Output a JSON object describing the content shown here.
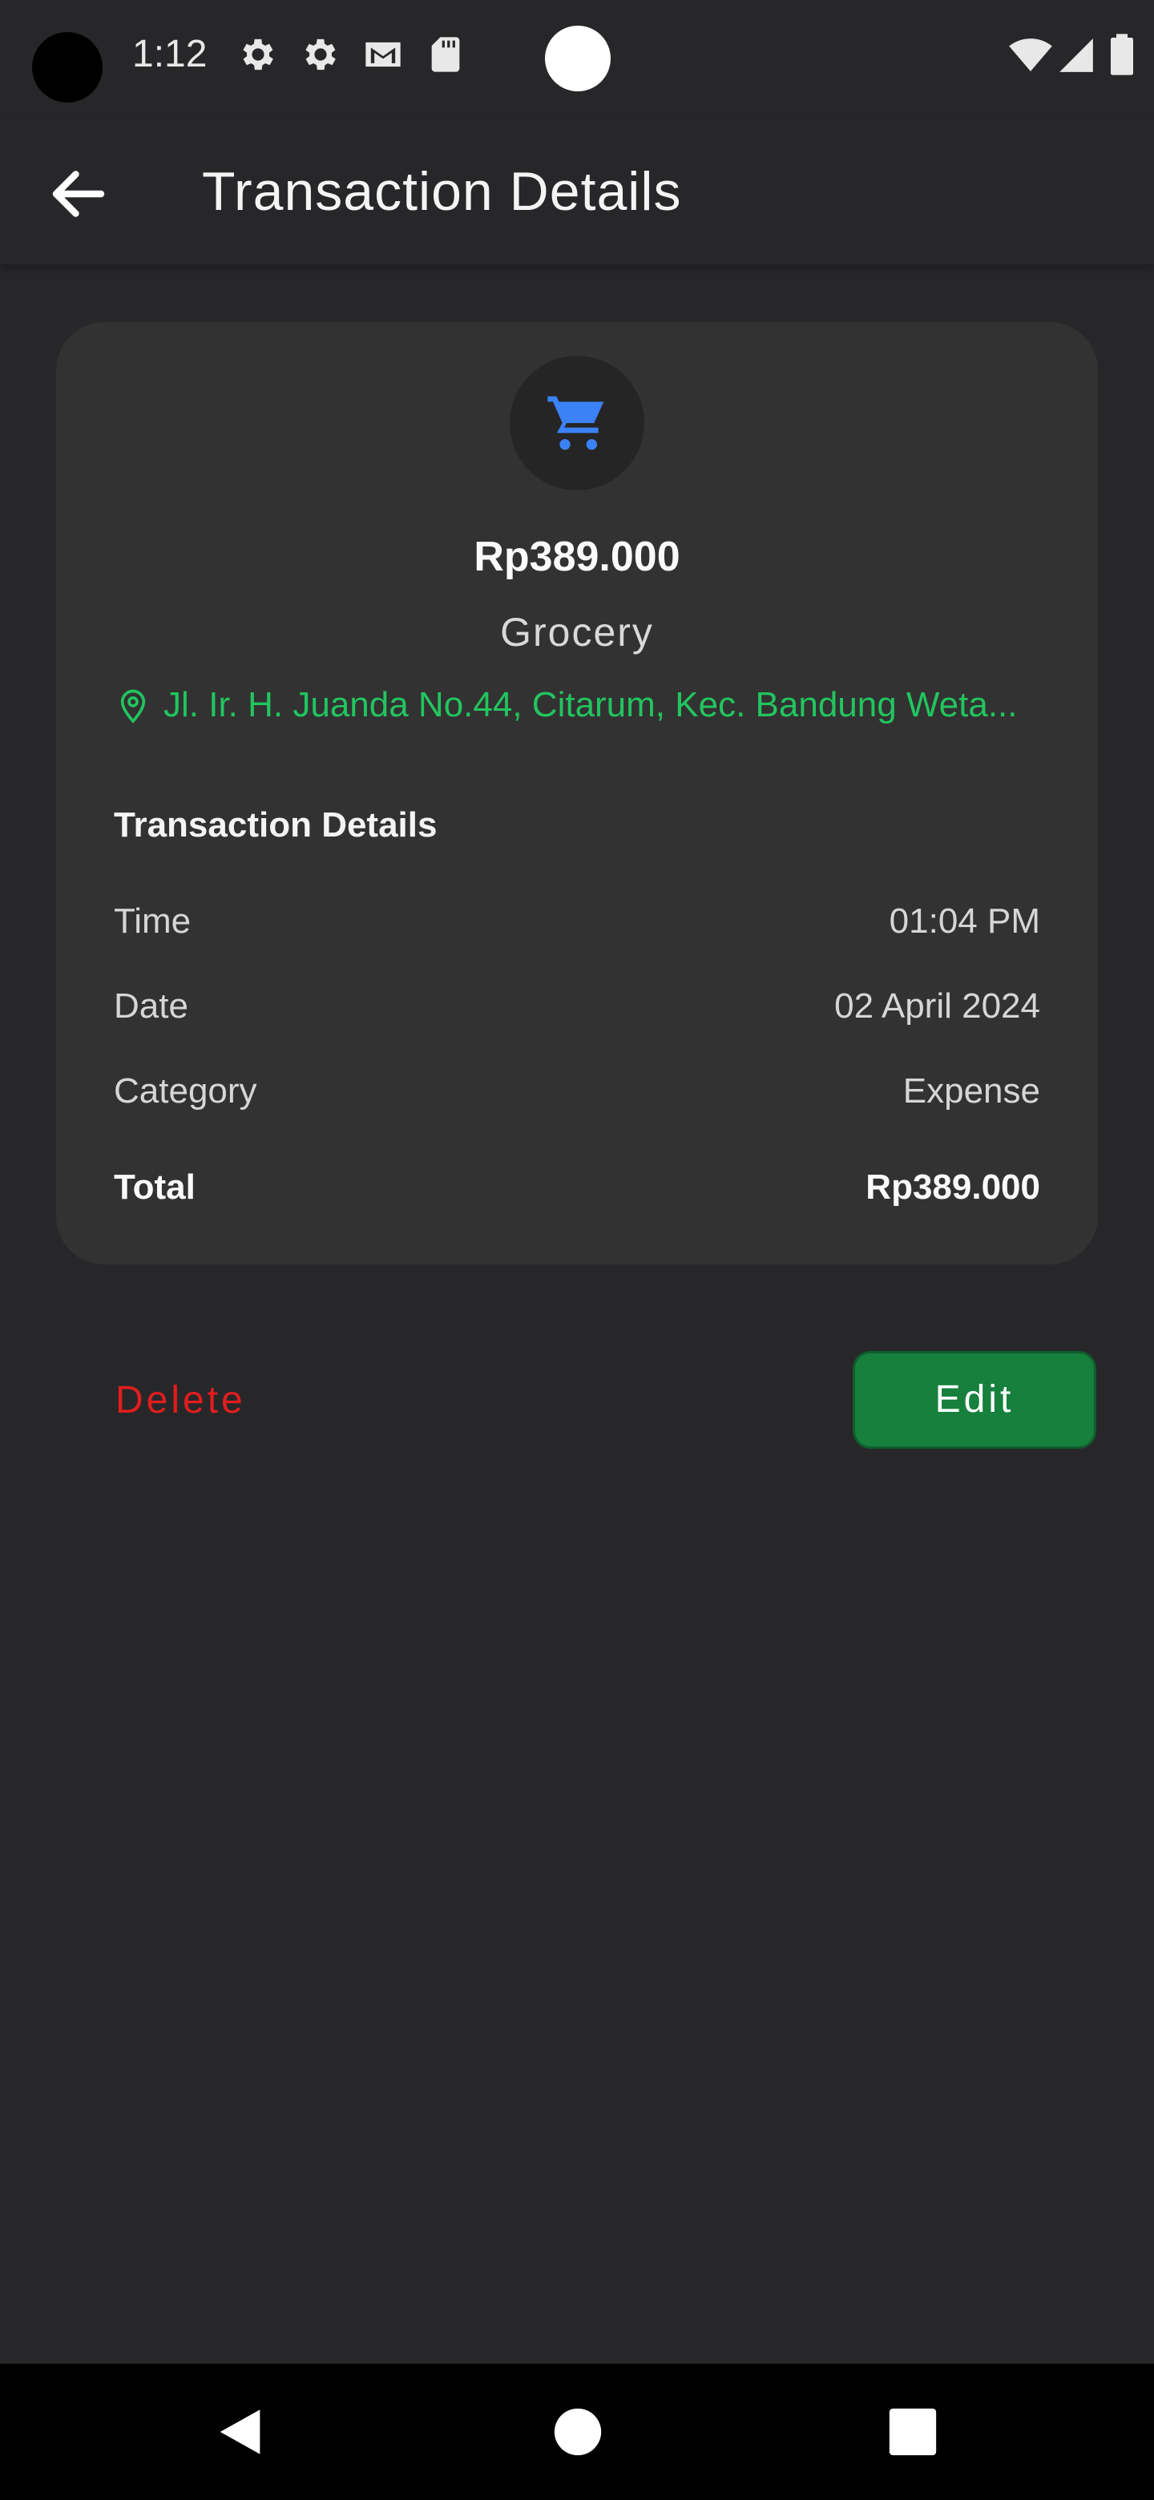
{
  "status_bar": {
    "time": "1:12",
    "icons": [
      "settings-icon",
      "settings-icon",
      "gmail-icon",
      "sd-card-icon",
      "wifi-icon",
      "cellular-signal-icon",
      "battery-icon"
    ]
  },
  "app_bar": {
    "title": "Transaction Details",
    "back_icon": "arrow-left-icon"
  },
  "transaction": {
    "icon": "shopping-cart-icon",
    "icon_color": "#3b82f6",
    "amount": "Rp389.000",
    "category_name": "Grocery",
    "location": "Jl. Ir. H. Juanda No.44, Citarum, Kec. Bandung Weta...",
    "location_color": "#22c55e"
  },
  "details": {
    "title": "Transaction Details",
    "rows": [
      {
        "label": "Time",
        "value": "01:04 PM"
      },
      {
        "label": "Date",
        "value": "02 April 2024"
      },
      {
        "label": "Category",
        "value": "Expense"
      }
    ],
    "total": {
      "label": "Total",
      "value": "Rp389.000"
    }
  },
  "actions": {
    "delete_label": "Delete",
    "delete_color": "#e11d1d",
    "edit_label": "Edit",
    "edit_color": "#17803d"
  },
  "nav_bar": {
    "buttons": [
      "back-triangle-icon",
      "home-circle-icon",
      "recents-square-icon"
    ]
  }
}
